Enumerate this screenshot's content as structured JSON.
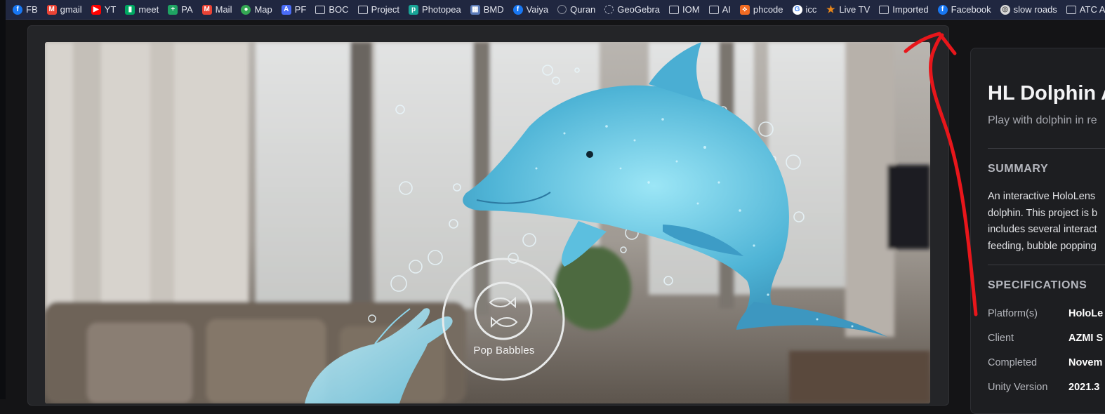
{
  "bookmarks": [
    {
      "label": "FB",
      "icon": "facebook-icon",
      "color": "#1877f2"
    },
    {
      "label": "gmail",
      "icon": "gmail-icon",
      "color": "#ea4335"
    },
    {
      "label": "YT",
      "icon": "youtube-icon",
      "color": "#ff0000"
    },
    {
      "label": "meet",
      "icon": "meet-icon",
      "color": "#00a862"
    },
    {
      "label": "PA",
      "icon": "pa-icon",
      "color": "#1fa463"
    },
    {
      "label": "Mail",
      "icon": "mail-icon",
      "color": "#ea4335"
    },
    {
      "label": "Map",
      "icon": "map-pin-icon",
      "color": "#34a853"
    },
    {
      "label": "PF",
      "icon": "pf-icon",
      "color": "#4a6cf7"
    },
    {
      "label": "BOC",
      "icon": "folder-icon",
      "color": ""
    },
    {
      "label": "Project",
      "icon": "folder-icon",
      "color": ""
    },
    {
      "label": "Photopea",
      "icon": "photopea-icon",
      "color": "#18a497"
    },
    {
      "label": "BMD",
      "icon": "bmd-icon",
      "color": "#5b7bb8"
    },
    {
      "label": "Vaiya",
      "icon": "facebook-icon",
      "color": "#1877f2"
    },
    {
      "label": "Quran",
      "icon": "quran-icon",
      "color": ""
    },
    {
      "label": "GeoGebra",
      "icon": "geogebra-icon",
      "color": ""
    },
    {
      "label": "IOM",
      "icon": "folder-icon",
      "color": ""
    },
    {
      "label": "AI",
      "icon": "folder-icon",
      "color": ""
    },
    {
      "label": "phcode",
      "icon": "phcode-icon",
      "color": "#f26b22"
    },
    {
      "label": "icc",
      "icon": "google-icon",
      "color": "#ffffff"
    },
    {
      "label": "Live TV",
      "icon": "star-icon",
      "color": "#e8861a"
    },
    {
      "label": "Imported",
      "icon": "folder-icon",
      "color": ""
    },
    {
      "label": "Facebook",
      "icon": "facebook-icon",
      "color": "#1877f2"
    },
    {
      "label": "slow roads",
      "icon": "slow-roads-icon",
      "color": "#d9d9d9"
    },
    {
      "label": "ATC Asset",
      "icon": "folder-icon",
      "color": ""
    }
  ],
  "hero": {
    "button_label": "Pop Babbles",
    "button_icon": "fish-icon"
  },
  "project": {
    "title": "HL Dolphin A",
    "subtitle": "Play with dolphin in re",
    "summary_heading": "SUMMARY",
    "summary_lines": [
      "An interactive HoloLens",
      "dolphin. This project is b",
      "includes several interact",
      "feeding, bubble popping"
    ],
    "specs_heading": "SPECIFICATIONS",
    "specs": [
      {
        "label": "Platform(s)",
        "value": "HoloLe"
      },
      {
        "label": "Client",
        "value": "AZMI S"
      },
      {
        "label": "Completed",
        "value": "Novem"
      },
      {
        "label": "Unity Version",
        "value": "2021.3"
      }
    ]
  },
  "colors": {
    "bookmark_bar": "#202740",
    "annotation_stroke": "#e8161b",
    "dolphin": "#5fc4df"
  }
}
